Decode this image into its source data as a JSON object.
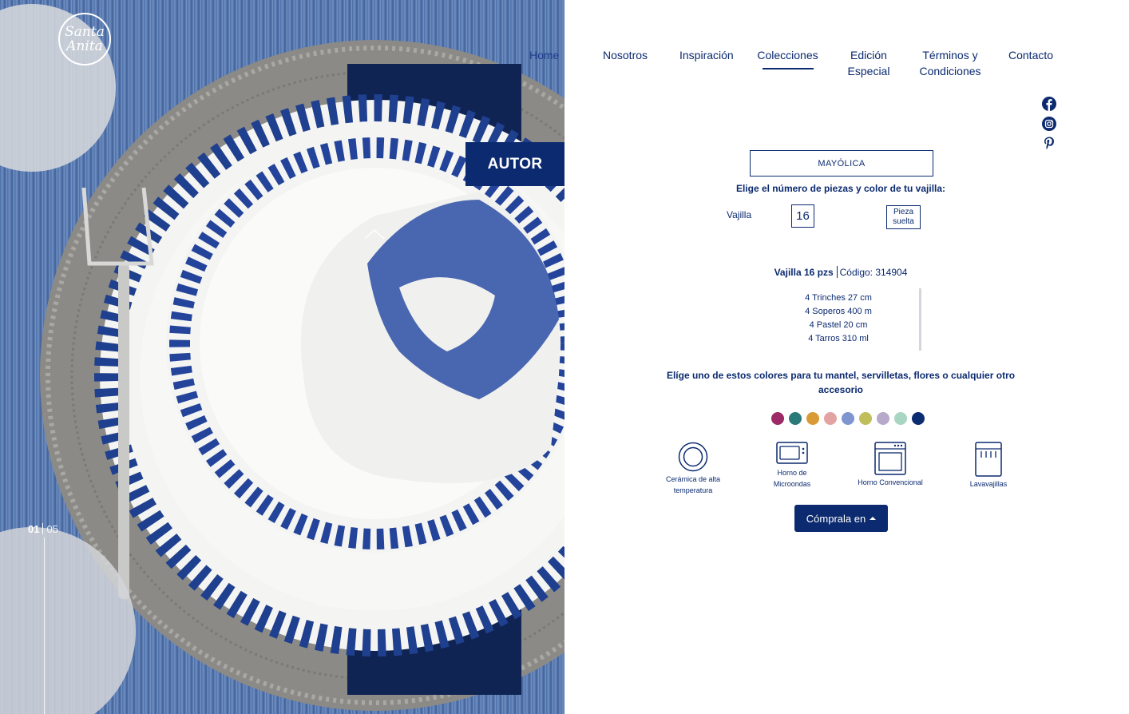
{
  "brand": {
    "logo_text_1": "Santa",
    "logo_text_2": "Anita"
  },
  "hero": {
    "badge": "AUTOR",
    "pager_current": "01",
    "pager_total": "05"
  },
  "nav": {
    "home": "Home",
    "nosotros": "Nosotros",
    "inspiracion": "Inspiración",
    "colecciones": "Colecciones",
    "edicion_1": "Edición",
    "edicion_2": "Especial",
    "terminos_1": "Términos y",
    "terminos_2": "Condiciones",
    "contacto": "Contacto"
  },
  "social": [
    "facebook-icon",
    "instagram-icon",
    "pinterest-icon"
  ],
  "product": {
    "collection": "MAYÓLICA",
    "choose_label": "Elige el número de piezas y color de tu vajilla:",
    "vajilla_label": "Vajilla",
    "set_option": "16",
    "pieza_1": "Pieza",
    "pieza_2": "suelta",
    "set_name": "Vajilla 16 pzs",
    "code": "Código: 314904",
    "pieces": [
      "4 Trinches 27 cm",
      "4 Soperos 400 m",
      "4 Pastel 20 cm",
      "4 Tarros 310 ml"
    ],
    "colors_title_1": "Elíge uno de estos colores para tu mantel, servilletas, flores o cualquier otro",
    "colors_title_2": "accesorio",
    "swatches": [
      "#9b2a66",
      "#2a7a7a",
      "#d99a35",
      "#e4a3a3",
      "#7f95cf",
      "#bfbe5a",
      "#b7a9c9",
      "#a9d6c2",
      "#0c2c72"
    ],
    "features": [
      {
        "icon": "plate-icon",
        "l1": "Cerámica de alta",
        "l2": "temperatura"
      },
      {
        "icon": "microwave-icon",
        "l1": "Horno de",
        "l2": "Microondas"
      },
      {
        "icon": "oven-icon",
        "l1": "Horno Convencional",
        "l2": ""
      },
      {
        "icon": "dishwasher-icon",
        "l1": "Lavavajillas",
        "l2": ""
      }
    ],
    "buy_label": "Cómprala en"
  }
}
